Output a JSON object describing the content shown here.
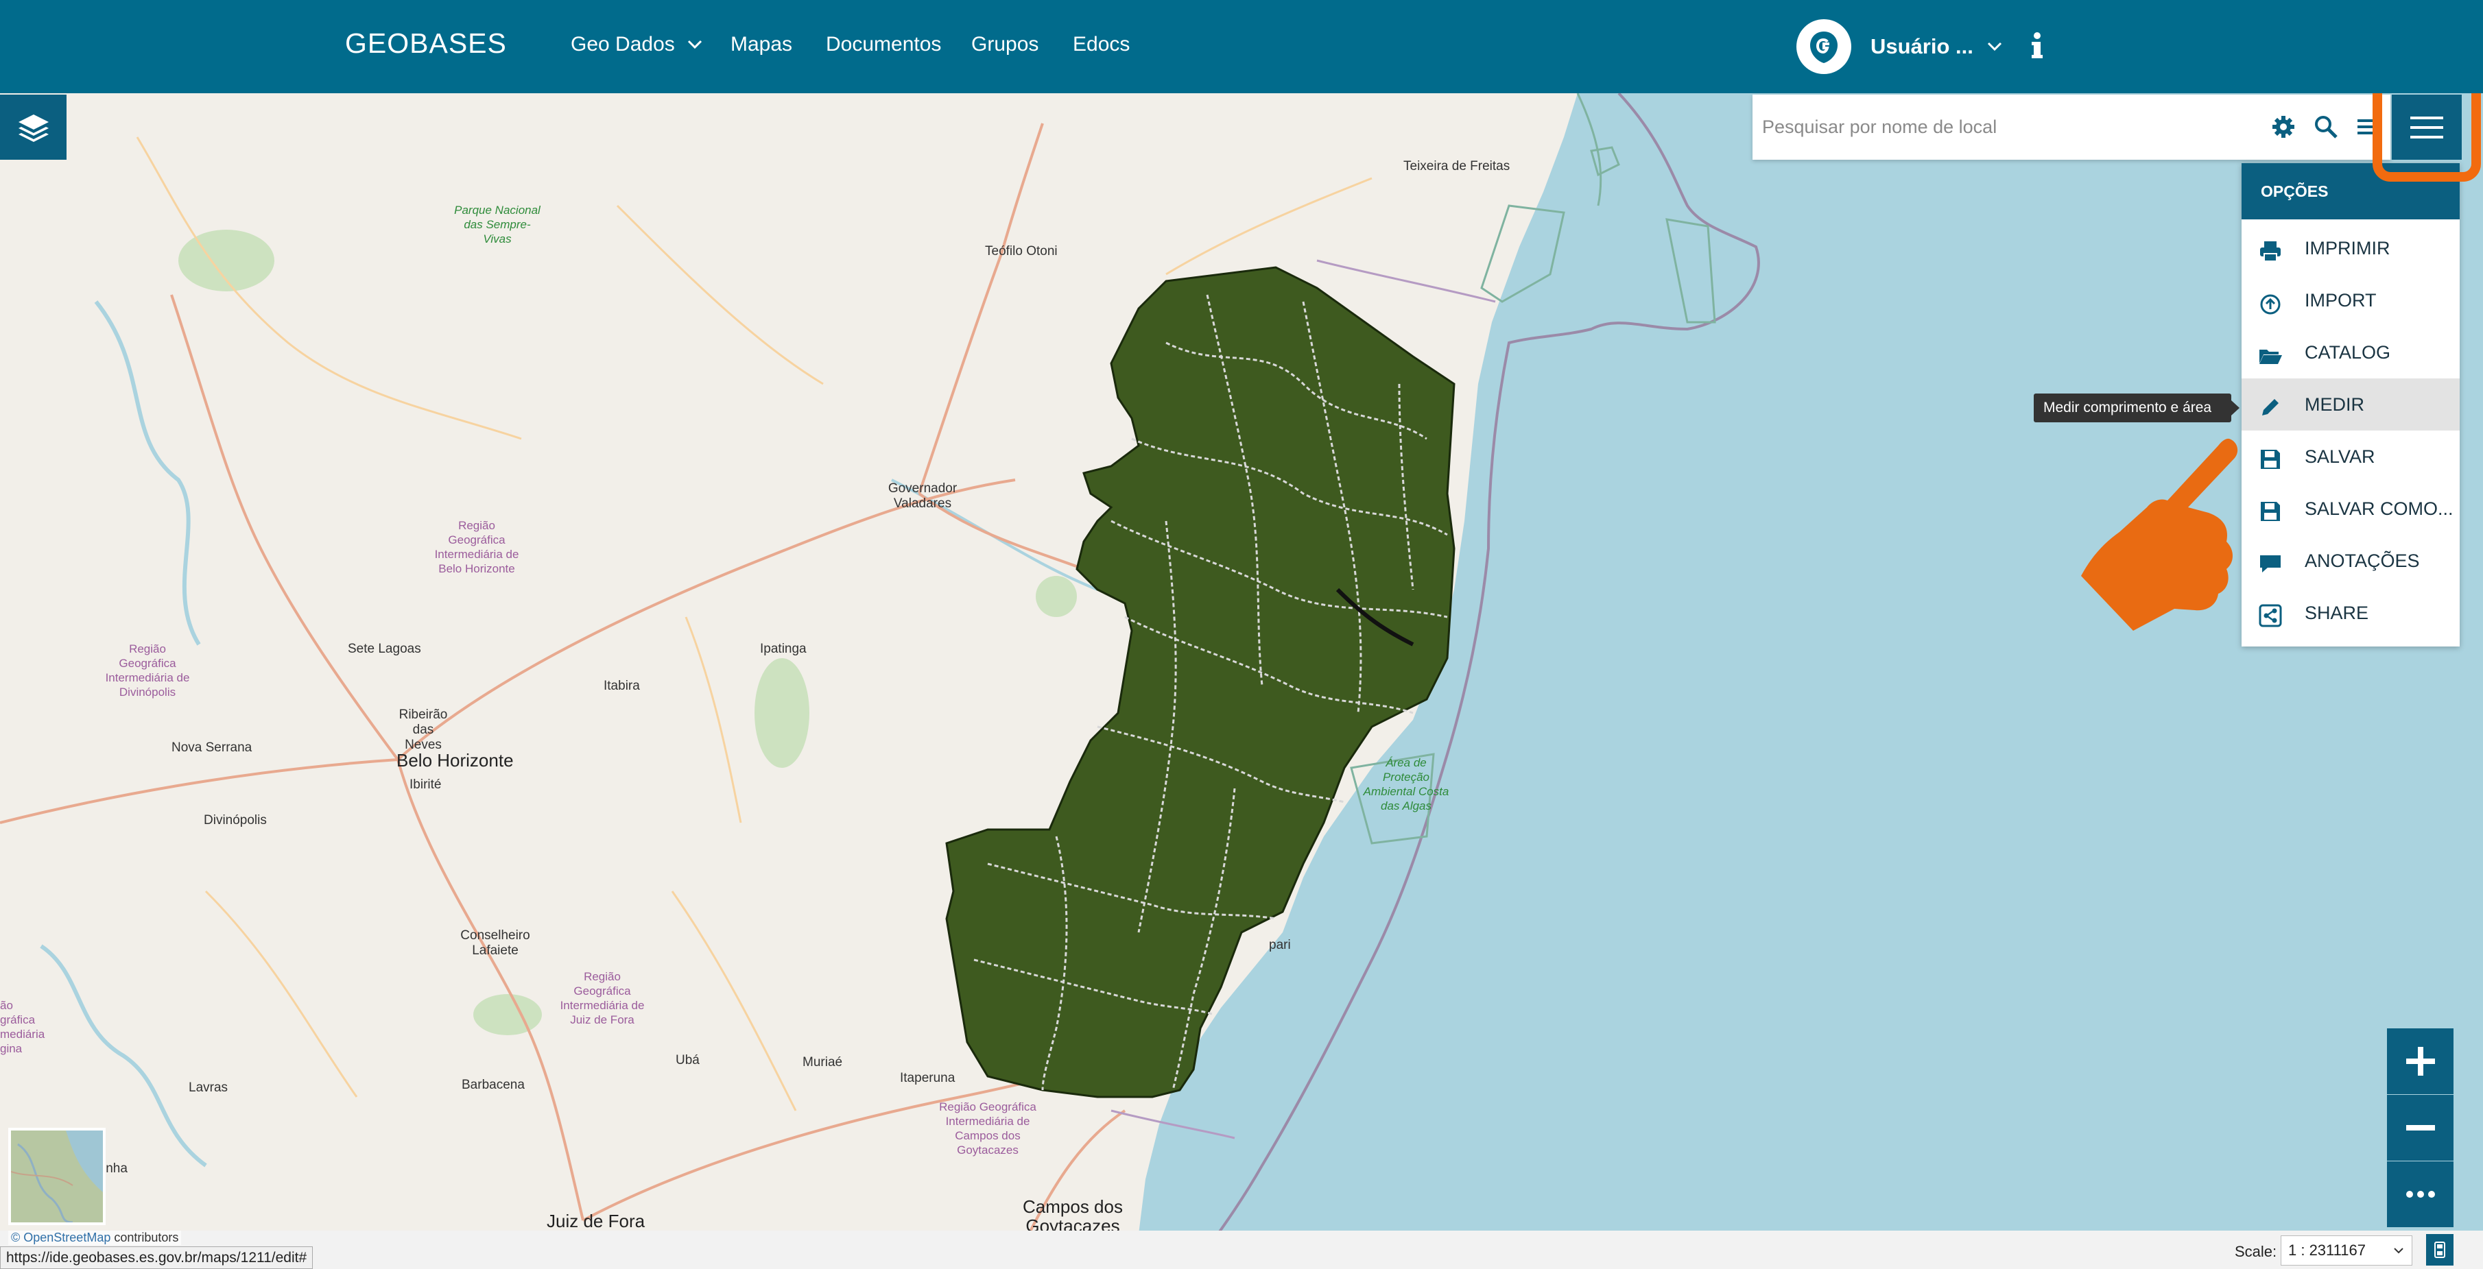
{
  "app": {
    "brand": "GEOBASES"
  },
  "nav": {
    "items": [
      {
        "label": "Geo Dados",
        "has_dropdown": true
      },
      {
        "label": "Mapas"
      },
      {
        "label": "Documentos"
      },
      {
        "label": "Grupos"
      },
      {
        "label": "Edocs"
      }
    ]
  },
  "user": {
    "name": "Usuário ...",
    "avatar_icon": "geobases-logo-icon"
  },
  "search": {
    "placeholder": "Pesquisar por nome de local",
    "value": ""
  },
  "options_menu": {
    "title": "OPÇÕES",
    "items": [
      {
        "label": "IMPRIMIR",
        "icon": "printer-icon"
      },
      {
        "label": "IMPORT",
        "icon": "upload-icon"
      },
      {
        "label": "CATALOG",
        "icon": "folder-open-icon"
      },
      {
        "label": "MEDIR",
        "icon": "pencil-icon",
        "active": true
      },
      {
        "label": "SALVAR",
        "icon": "floppy-icon"
      },
      {
        "label": "SALVAR COMO...",
        "icon": "floppy-icon"
      },
      {
        "label": "ANOTAÇÕES",
        "icon": "comment-icon"
      },
      {
        "label": "SHARE",
        "icon": "share-icon"
      }
    ],
    "tooltip": "Medir comprimento e área"
  },
  "map": {
    "places": [
      "Teixeira de Freitas",
      "Teófilo Otoni",
      "Governador Valadares",
      "Sete Lagoas",
      "Ipatinga",
      "Itabira",
      "Ribeirão das Neves",
      "Belo Horizonte",
      "Ibirité",
      "Nova Serrana",
      "Divinópolis",
      "Conselheiro Lafaiete",
      "Ubá",
      "Muriaé",
      "Itaperuna",
      "Barbacena",
      "Lavras",
      "Juiz de Fora",
      "Campos dos Goytacazes",
      "pari",
      "inha"
    ],
    "regions": [
      "Região Geográfica Intermediária de Belo Horizonte",
      "Região Geográfica Intermediária de Divinópolis",
      "Região Geográfica Intermediária de Juiz de Fora",
      "Região Geográfica Intermediária de Campos dos Goytacazes",
      "ão gráfica mediária gina"
    ],
    "parks": [
      "Parque Nacional das Sempre-Vivas",
      "Área de Proteção Ambiental Costa das Algas"
    ],
    "attribution_link": "© OpenStreetMap",
    "attribution_rest": "contributors"
  },
  "zoom": {
    "in_icon": "plus-icon",
    "out_icon": "minus-icon",
    "more_icon": "ellipsis-icon"
  },
  "status": {
    "url": "https://ide.geobases.es.gov.br/maps/1211/edit#",
    "scale_label": "Scale:",
    "scale_value": "1 : 2311167"
  },
  "colors": {
    "navbar": "#016b8c",
    "button": "#0b5f80",
    "highlight": "#f26b0f",
    "sea": "#aad3df",
    "land": "#f2efe9",
    "state_fill": "#3e5a1f"
  }
}
